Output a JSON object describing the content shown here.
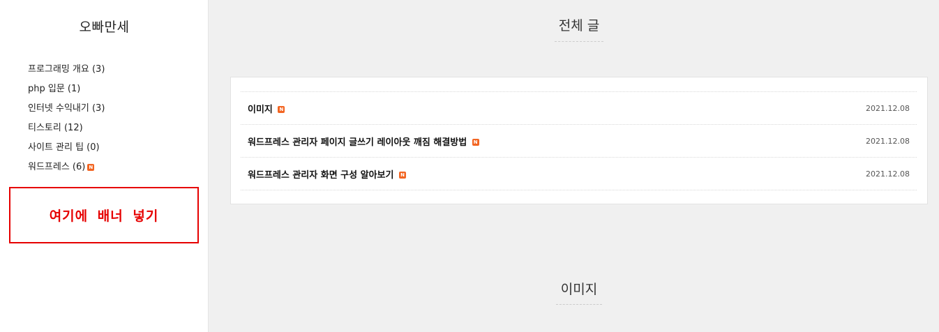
{
  "sidebar": {
    "blog_title": "오빠만세",
    "categories": [
      {
        "label": "프로그래밍 개요 (3)",
        "new": false
      },
      {
        "label": "php 입문 (1)",
        "new": false
      },
      {
        "label": "인터넷 수익내기 (3)",
        "new": false
      },
      {
        "label": "티스토리 (12)",
        "new": false
      },
      {
        "label": "사이트 관리 팁 (0)",
        "new": false
      },
      {
        "label": "워드프레스 (6)",
        "new": true
      }
    ],
    "banner_text": "여기에 배너 넣기",
    "new_badge": "N"
  },
  "main": {
    "section_title": "전체 글",
    "posts": [
      {
        "title": "이미지",
        "date": "2021.12.08",
        "new": true
      },
      {
        "title": "워드프레스 관리자 페이지 글쓰기 레이아웃 깨짐 해결방법",
        "date": "2021.12.08",
        "new": true
      },
      {
        "title": "워드프레스 관리자 화면 구성 알아보기",
        "date": "2021.12.08",
        "new": true
      }
    ],
    "next_section_title": "이미지"
  },
  "colors": {
    "badge": "#f26522",
    "banner": "#e60000",
    "background": "#f0f0f0"
  }
}
